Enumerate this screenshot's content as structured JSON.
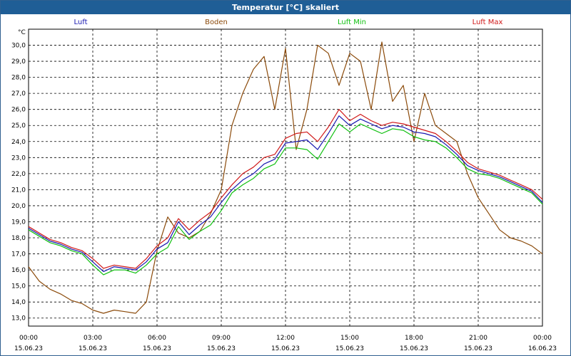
{
  "window": {
    "title": "Temperatur [°C] skaliert"
  },
  "chart_data": {
    "type": "line",
    "title": "Temperatur [°C] skaliert",
    "ylabel": "°C",
    "ylim": [
      12.5,
      31.0
    ],
    "yticks": [
      13.0,
      14.0,
      15.0,
      16.0,
      17.0,
      18.0,
      19.0,
      20.0,
      21.0,
      22.0,
      23.0,
      24.0,
      25.0,
      26.0,
      27.0,
      28.0,
      29.0,
      30.0
    ],
    "ytick_labels": [
      "13,0",
      "14,0",
      "15,0",
      "16,0",
      "17,0",
      "18,0",
      "19,0",
      "20,0",
      "21,0",
      "22,0",
      "23,0",
      "24,0",
      "25,0",
      "26,0",
      "27,0",
      "28,0",
      "29,0",
      "30,0"
    ],
    "xlim": [
      0,
      24
    ],
    "xticks": [
      0,
      3,
      6,
      9,
      12,
      15,
      18,
      21,
      24
    ],
    "xtick_times": [
      "00:00",
      "03:00",
      "06:00",
      "09:00",
      "12:00",
      "15:00",
      "18:00",
      "21:00",
      "00:00"
    ],
    "xtick_dates": [
      "15.06.23",
      "15.06.23",
      "15.06.23",
      "15.06.23",
      "15.06.23",
      "15.06.23",
      "15.06.23",
      "15.06.23",
      "16.06.23"
    ],
    "grid": true,
    "legend_position": "top",
    "series": [
      {
        "name": "Luft",
        "color": "#1818b0",
        "x": [
          0,
          0.5,
          1,
          1.5,
          2,
          2.5,
          3,
          3.5,
          4,
          4.5,
          5,
          5.5,
          6,
          6.5,
          7,
          7.5,
          8,
          8.5,
          9,
          9.5,
          10,
          10.5,
          11,
          11.5,
          12,
          12.5,
          13,
          13.5,
          14,
          14.5,
          15,
          15.5,
          16,
          16.5,
          17,
          17.5,
          18,
          18.5,
          19,
          19.5,
          20,
          20.5,
          21,
          21.5,
          22,
          22.5,
          23,
          23.5,
          24
        ],
        "y": [
          18.6,
          18.2,
          17.8,
          17.6,
          17.3,
          17.1,
          16.5,
          15.9,
          16.2,
          16.1,
          16.0,
          16.5,
          17.3,
          17.7,
          19.0,
          18.2,
          18.8,
          19.3,
          20.2,
          21.0,
          21.6,
          22.0,
          22.6,
          22.9,
          23.9,
          24.0,
          24.1,
          23.5,
          24.5,
          25.6,
          25.0,
          25.4,
          25.1,
          24.8,
          25.0,
          24.9,
          24.6,
          24.5,
          24.3,
          23.8,
          23.2,
          22.5,
          22.2,
          22.0,
          21.8,
          21.5,
          21.2,
          20.9,
          20.2
        ]
      },
      {
        "name": "Boden",
        "color": "#8b4a0a",
        "x": [
          0,
          0.5,
          1,
          1.5,
          2,
          2.5,
          3,
          3.5,
          4,
          4.5,
          5,
          5.5,
          6,
          6.5,
          7,
          7.5,
          8,
          8.5,
          9,
          9.5,
          10,
          10.5,
          11,
          11.5,
          12,
          12.5,
          13,
          13.5,
          14,
          14.5,
          15,
          15.5,
          16,
          16.5,
          17,
          17.5,
          18,
          18.5,
          19,
          19.5,
          20,
          20.5,
          21,
          21.5,
          22,
          22.5,
          23,
          23.5,
          24
        ],
        "y": [
          16.2,
          15.3,
          14.8,
          14.5,
          14.1,
          13.9,
          13.5,
          13.3,
          13.5,
          13.4,
          13.3,
          14.0,
          17.2,
          19.3,
          18.3,
          18.0,
          18.4,
          19.5,
          21.0,
          25.0,
          27.0,
          28.5,
          29.3,
          26.0,
          29.8,
          23.5,
          26.0,
          30.0,
          29.5,
          27.5,
          29.5,
          29.0,
          26.0,
          30.2,
          26.5,
          27.5,
          24.0,
          27.0,
          25.0,
          24.5,
          24.0,
          22.0,
          20.5,
          19.5,
          18.5,
          18.0,
          17.8,
          17.5,
          17.0
        ]
      },
      {
        "name": "Luft Min",
        "color": "#10c010",
        "x": [
          0,
          0.5,
          1,
          1.5,
          2,
          2.5,
          3,
          3.5,
          4,
          4.5,
          5,
          5.5,
          6,
          6.5,
          7,
          7.5,
          8,
          8.5,
          9,
          9.5,
          10,
          10.5,
          11,
          11.5,
          12,
          12.5,
          13,
          13.5,
          14,
          14.5,
          15,
          15.5,
          16,
          16.5,
          17,
          17.5,
          18,
          18.5,
          19,
          19.5,
          20,
          20.5,
          21,
          21.5,
          22,
          22.5,
          23,
          23.5,
          24
        ],
        "y": [
          18.5,
          18.1,
          17.7,
          17.5,
          17.2,
          17.0,
          16.3,
          15.7,
          16.0,
          16.0,
          15.8,
          16.3,
          17.0,
          17.4,
          18.7,
          17.9,
          18.4,
          18.8,
          19.7,
          20.8,
          21.3,
          21.7,
          22.3,
          22.6,
          23.6,
          23.6,
          23.5,
          22.9,
          24.0,
          25.1,
          24.6,
          25.1,
          24.8,
          24.5,
          24.8,
          24.7,
          24.3,
          24.1,
          24.0,
          23.6,
          23.0,
          22.3,
          22.0,
          21.9,
          21.7,
          21.4,
          21.1,
          20.8,
          20.1
        ]
      },
      {
        "name": "Luft Max",
        "color": "#d01818",
        "x": [
          0,
          0.5,
          1,
          1.5,
          2,
          2.5,
          3,
          3.5,
          4,
          4.5,
          5,
          5.5,
          6,
          6.5,
          7,
          7.5,
          8,
          8.5,
          9,
          9.5,
          10,
          10.5,
          11,
          11.5,
          12,
          12.5,
          13,
          13.5,
          14,
          14.5,
          15,
          15.5,
          16,
          16.5,
          17,
          17.5,
          18,
          18.5,
          19,
          19.5,
          20,
          20.5,
          21,
          21.5,
          22,
          22.5,
          23,
          23.5,
          24
        ],
        "y": [
          18.7,
          18.3,
          17.9,
          17.7,
          17.4,
          17.2,
          16.7,
          16.1,
          16.3,
          16.2,
          16.1,
          16.7,
          17.5,
          18.0,
          19.2,
          18.5,
          19.1,
          19.6,
          20.5,
          21.3,
          22.0,
          22.4,
          23.0,
          23.2,
          24.2,
          24.5,
          24.6,
          24.0,
          24.9,
          26.0,
          25.3,
          25.7,
          25.3,
          25.0,
          25.2,
          25.1,
          24.9,
          24.7,
          24.5,
          24.0,
          23.4,
          22.7,
          22.3,
          22.1,
          21.9,
          21.6,
          21.3,
          21.0,
          20.4
        ]
      }
    ]
  }
}
